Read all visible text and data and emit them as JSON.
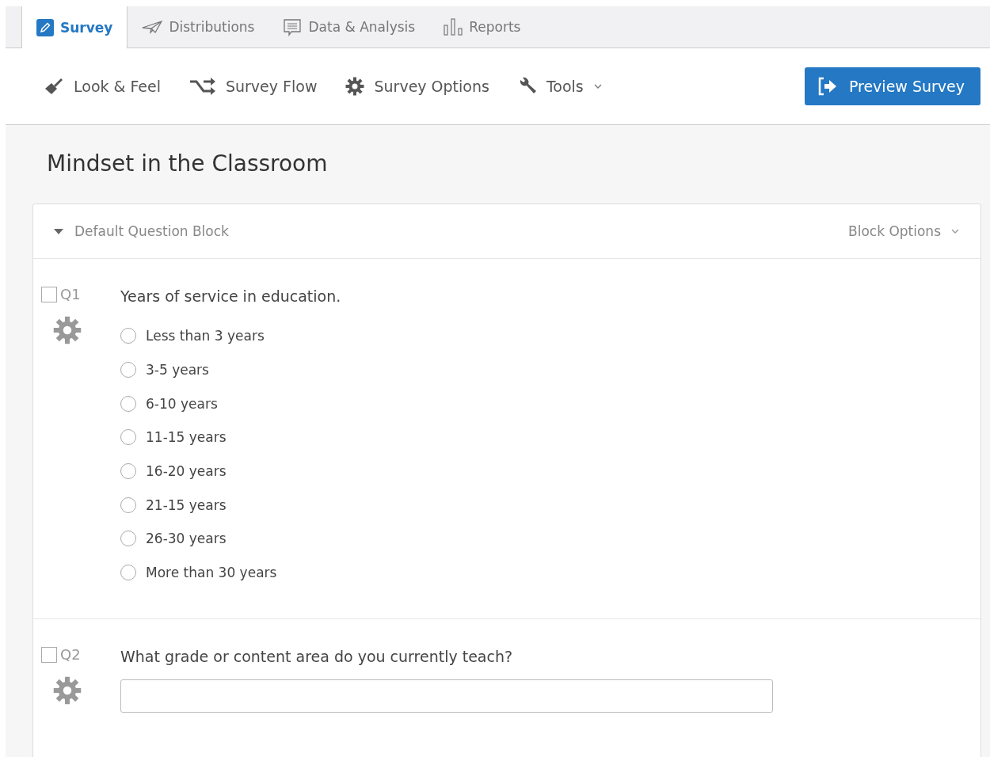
{
  "tabs": [
    {
      "label": "Survey",
      "selected": true
    },
    {
      "label": "Distributions",
      "selected": false
    },
    {
      "label": "Data & Analysis",
      "selected": false
    },
    {
      "label": "Reports",
      "selected": false
    }
  ],
  "toolbar": [
    {
      "label": "Look & Feel"
    },
    {
      "label": "Survey Flow"
    },
    {
      "label": "Survey Options"
    },
    {
      "label": "Tools",
      "dropdown": true
    }
  ],
  "preview_button": "Preview Survey",
  "survey_title": "Mindset in the Classroom",
  "block": {
    "title": "Default Question Block",
    "expanded": true,
    "options": "Block Options"
  },
  "questions": [
    {
      "number": "Q1",
      "checked": false,
      "kind": "choice",
      "text": "Years of service in education.",
      "choices": [
        {
          "label": "Less than 3 years",
          "selected": false
        },
        {
          "label": "3-5 years",
          "selected": false
        },
        {
          "label": "6-10 years",
          "selected": false
        },
        {
          "label": "11-15 years",
          "selected": false
        },
        {
          "label": "16-20 years",
          "selected": false
        },
        {
          "label": "21-15 years",
          "selected": false
        },
        {
          "label": "26-30 years",
          "selected": false
        },
        {
          "label": "More than 30 years",
          "selected": false
        }
      ]
    },
    {
      "number": "Q2",
      "checked": false,
      "kind": "text",
      "text": "What grade or content area do you currently teach?"
    }
  ]
}
